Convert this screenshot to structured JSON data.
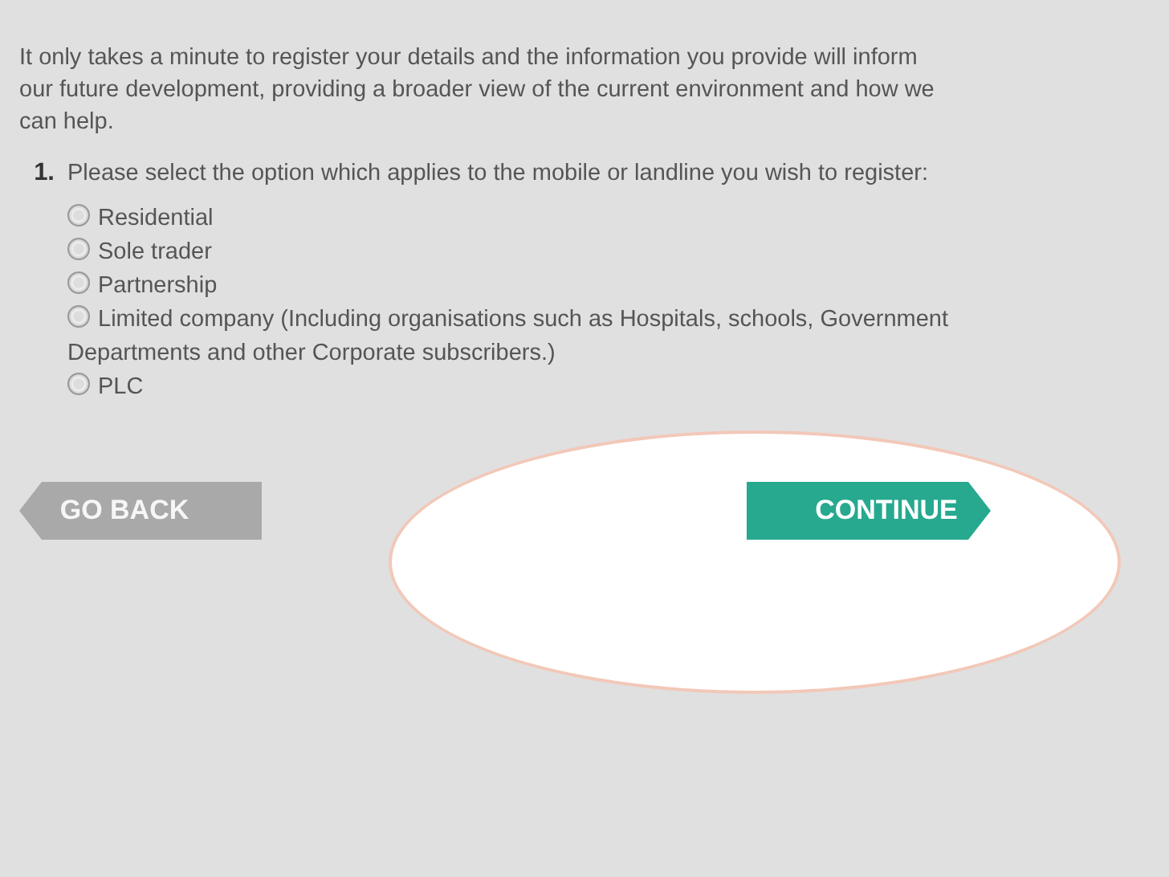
{
  "intro": "It only takes a minute to register your details and the information you provide will inform our future development, providing a broader view of the current environment and how we can help.",
  "question": {
    "number": "1.",
    "text": "Please select the option which applies to the mobile or landline you wish to register:"
  },
  "options": [
    {
      "label": "Residential",
      "selected": false
    },
    {
      "label": "Sole trader",
      "selected": false
    },
    {
      "label": "Partnership",
      "selected": false
    },
    {
      "label": "Limited company (Including organisations such as Hospitals, schools, Government Departments and other Corporate subscribers.)",
      "selected": false
    },
    {
      "label": "PLC",
      "selected": false
    }
  ],
  "buttons": {
    "back": {
      "label": "GO BACK",
      "disabled": true
    },
    "continue": {
      "label": "CONTINUE",
      "disabled": false
    }
  }
}
